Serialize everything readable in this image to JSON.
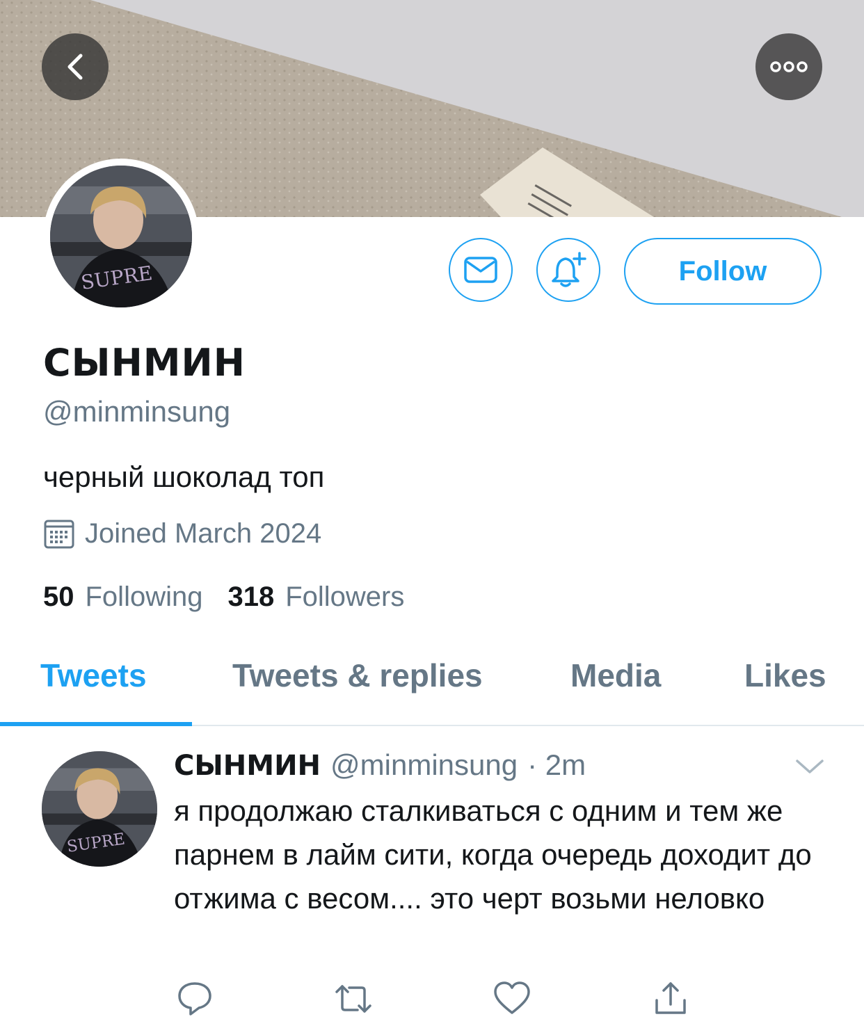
{
  "header": {
    "back_icon": "chevron-left-icon",
    "more_icon": "ellipsis-icon"
  },
  "profile": {
    "display_name": "СЫНМИН",
    "handle": "@minminsung",
    "bio": "черный шоколад топ",
    "joined": "Joined March 2024",
    "following_count": "50",
    "following_label": "Following",
    "followers_count": "318",
    "followers_label": "Followers"
  },
  "actions": {
    "message_icon": "mail-icon",
    "notify_icon": "bell-plus-icon",
    "follow_label": "Follow"
  },
  "tabs": [
    {
      "label": "Tweets",
      "active": true
    },
    {
      "label": "Tweets & replies",
      "active": false
    },
    {
      "label": "Media",
      "active": false
    },
    {
      "label": "Likes",
      "active": false
    }
  ],
  "tweet": {
    "name": "СЫНМИН",
    "handle": "@minminsung",
    "time": "· 2m",
    "text": "я продолжаю сталкиваться с одним и тем же парнем в лайм сити, когда очередь доходит до отжима с весом.... это черт возьми неловко"
  },
  "colors": {
    "accent": "#1da1f2",
    "secondary_text": "#657786"
  }
}
